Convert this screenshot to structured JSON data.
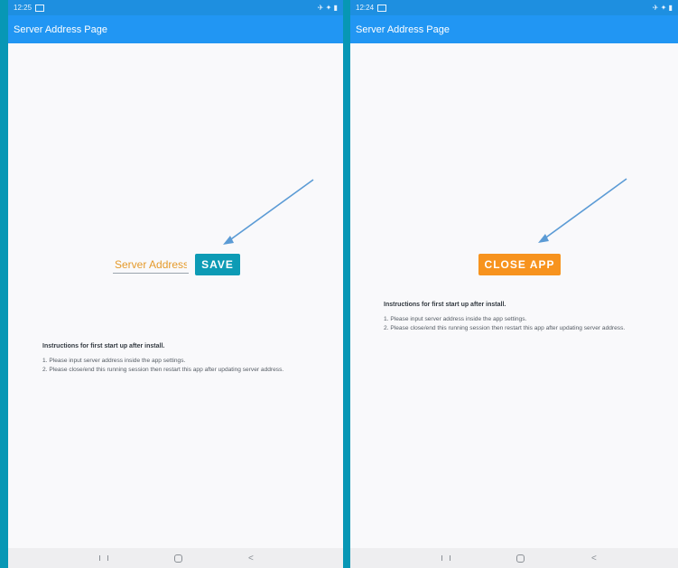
{
  "left": {
    "status": {
      "time": "12:25",
      "icons": "✈ ✦ ▮"
    },
    "app_bar": {
      "title": "Server Address Page"
    },
    "address_input": {
      "placeholder": "Server Address"
    },
    "save_button": {
      "label": "SAVE"
    },
    "instructions": {
      "title": "Instructions for first start up after install.",
      "items": [
        "1. Please input server address inside the app settings.",
        "2. Please close/end this running session then restart this app after updating server address."
      ]
    }
  },
  "right": {
    "status": {
      "time": "12:24",
      "icons": "✈ ✦ ▮"
    },
    "app_bar": {
      "title": "Server Address Page"
    },
    "close_button": {
      "label": "CLOSE APP"
    },
    "instructions": {
      "title": "Instructions for first start up after install.",
      "items": [
        "1. Please input server address inside the app settings.",
        "2. Please close/end this running session then restart this app after updating server address."
      ]
    }
  },
  "nav": {
    "back_glyph": "<"
  },
  "colors": {
    "app_bar": "#2196f3",
    "border": "#0797b5",
    "save_button": "#0d9bb5",
    "close_button": "#f7931e",
    "arrow": "#5b9bd5"
  }
}
